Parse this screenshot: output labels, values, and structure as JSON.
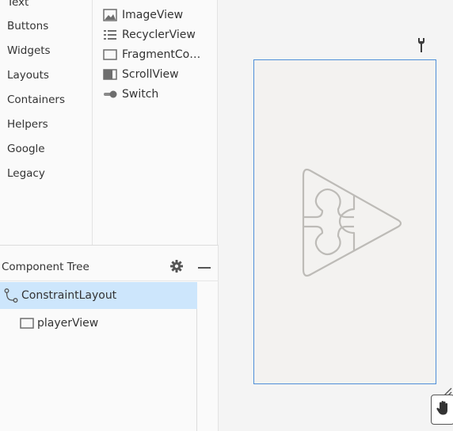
{
  "palette": {
    "categories": [
      "Text",
      "Buttons",
      "Widgets",
      "Layouts",
      "Containers",
      "Helpers",
      "Google",
      "Legacy"
    ],
    "widgets": [
      {
        "label": "ImageView",
        "icon": "image-icon"
      },
      {
        "label": "RecyclerView",
        "icon": "list-icon"
      },
      {
        "label": "FragmentCo…",
        "icon": "fragment-icon"
      },
      {
        "label": "ScrollView",
        "icon": "scrollview-icon"
      },
      {
        "label": "Switch",
        "icon": "switch-icon"
      }
    ]
  },
  "component_tree": {
    "title": "Component Tree",
    "items": [
      {
        "label": "ConstraintLayout",
        "icon": "constraint-layout-icon",
        "selected": true
      },
      {
        "label": "playerView",
        "icon": "view-icon",
        "selected": false
      }
    ]
  },
  "design": {
    "device_border_color": "#4f8fd8",
    "placeholder_icon": "puzzle-play-icon"
  },
  "colors": {
    "selection": "#cde6fc",
    "accent": "#4f8fd8"
  }
}
